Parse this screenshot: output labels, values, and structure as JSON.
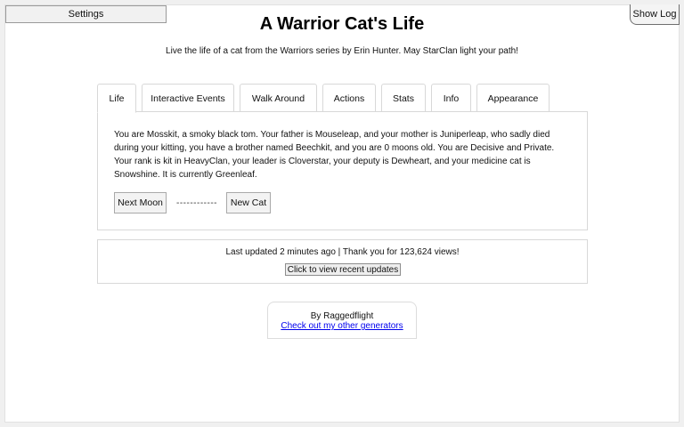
{
  "header": {
    "settings_label": "Settings",
    "show_log_label": "Show Log",
    "title": "A Warrior Cat's Life",
    "subtitle": "Live the life of a cat from the Warriors series by Erin Hunter. May StarClan light your path!"
  },
  "tabs": [
    {
      "label": "Life",
      "active": true
    },
    {
      "label": "Interactive Events"
    },
    {
      "label": "Walk Around"
    },
    {
      "label": "Actions"
    },
    {
      "label": "Stats"
    },
    {
      "label": "Info"
    },
    {
      "label": "Appearance"
    }
  ],
  "life": {
    "story": "You are Mosskit, a smoky black tom. Your father is Mouseleap, and your mother is Juniperleap, who sadly died during your kitting, you have a brother named Beechkit, and you are 0 moons old. You are Decisive and Private. Your rank is kit in HeavyClan, your leader is Cloverstar, your deputy is Dewheart, and your medicine cat is Snowshine. It is currently Greenleaf.",
    "next_moon_label": "Next Moon",
    "separator": "------------",
    "new_cat_label": "New Cat"
  },
  "updates": {
    "text": "Last updated 2 minutes ago | Thank you for 123,624 views!",
    "button_label": "Click to view recent updates"
  },
  "credit": {
    "author": "By Raggedflight",
    "link_text": "Check out my other generators"
  },
  "colors": {
    "link": "#0000ee",
    "border": "#d8d8d8",
    "button_bg": "#f3f3f3"
  }
}
